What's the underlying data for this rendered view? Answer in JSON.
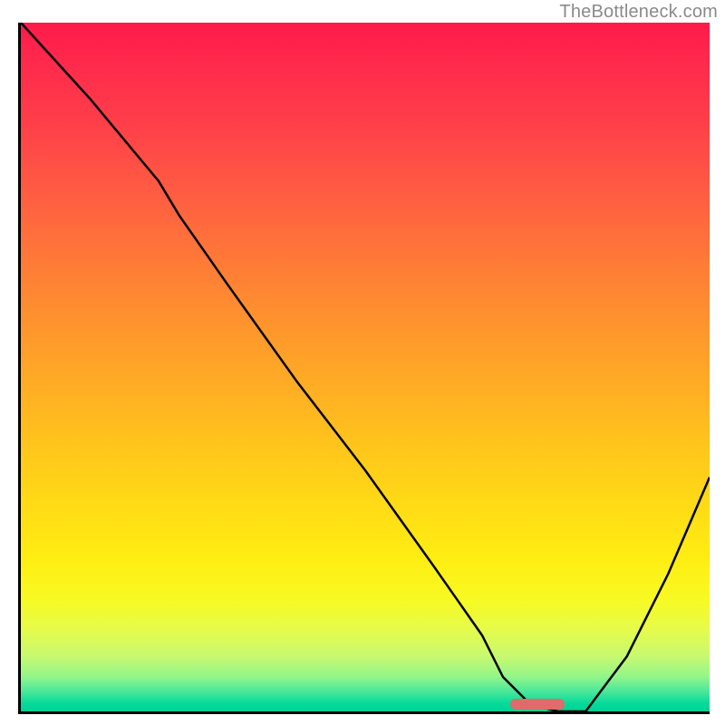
{
  "watermark": {
    "text": "TheBottleneck.com"
  },
  "axes": {
    "border_color": "#000000",
    "border_width_px": 3
  },
  "gradient": {
    "stops": [
      {
        "pct": 0,
        "color": "#ff1a4a"
      },
      {
        "pct": 6,
        "color": "#ff2a4c"
      },
      {
        "pct": 15,
        "color": "#ff4049"
      },
      {
        "pct": 24,
        "color": "#ff5a43"
      },
      {
        "pct": 33,
        "color": "#ff7539"
      },
      {
        "pct": 42,
        "color": "#ff8f2f"
      },
      {
        "pct": 51,
        "color": "#ffa826"
      },
      {
        "pct": 60,
        "color": "#ffc11d"
      },
      {
        "pct": 69,
        "color": "#ffd816"
      },
      {
        "pct": 78,
        "color": "#ffee12"
      },
      {
        "pct": 84,
        "color": "#f7fa24"
      },
      {
        "pct": 88,
        "color": "#e6fb4a"
      },
      {
        "pct": 92,
        "color": "#c7f96f"
      },
      {
        "pct": 95,
        "color": "#92f58a"
      },
      {
        "pct": 97,
        "color": "#4ee89a"
      },
      {
        "pct": 99,
        "color": "#00d99a"
      },
      {
        "pct": 100,
        "color": "#00d195"
      }
    ]
  },
  "marker": {
    "color": "#e16a6a",
    "x_pct": 71.0,
    "y_pct": 99.0,
    "width_pct": 8.0,
    "height_pct": 1.6
  },
  "chart_data": {
    "type": "line",
    "title": "",
    "xlabel": "",
    "ylabel": "",
    "xlim": [
      0,
      100
    ],
    "ylim": [
      0,
      100
    ],
    "x_meaning": "relative hardware balance position (percentage along x-axis)",
    "y_meaning": "bottleneck severity (percentage, 0 = none, 100 = max)",
    "series": [
      {
        "name": "bottleneck-curve",
        "color": "#000000",
        "x": [
          0,
          10,
          20,
          23,
          30,
          40,
          50,
          60,
          67,
          70,
          74,
          78,
          82,
          88,
          94,
          100
        ],
        "values": [
          100,
          89,
          77,
          72,
          62,
          48,
          35,
          21,
          11,
          5,
          1,
          0,
          0,
          8,
          20,
          34
        ]
      }
    ],
    "optimal_range": {
      "x_start": 71,
      "x_end": 79
    },
    "background_meaning": "vertical gradient maps y-value to color: high y (top) = red (bad), low y (bottom) = green (good)"
  }
}
